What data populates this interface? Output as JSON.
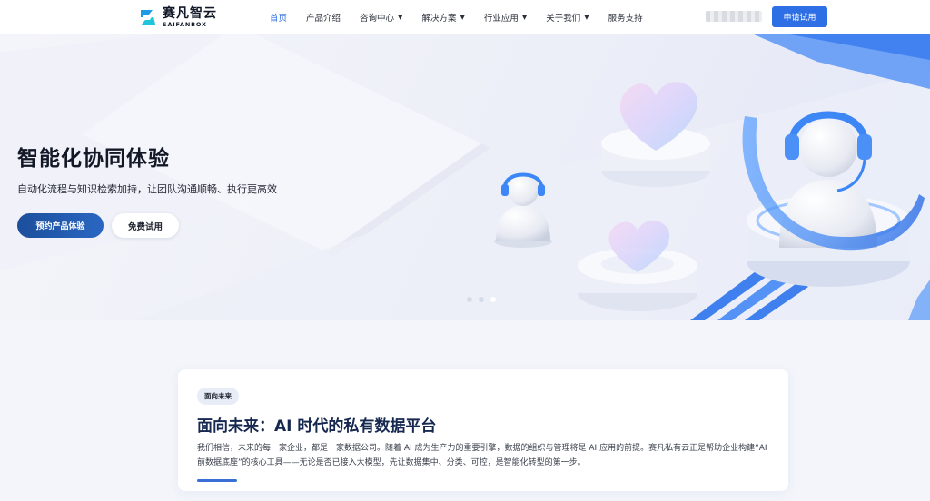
{
  "brand": {
    "name_cn": "赛凡智云",
    "name_en": "SAIFANBOX"
  },
  "nav": {
    "items": [
      {
        "label": "首页",
        "active": true,
        "dropdown": false
      },
      {
        "label": "产品介绍",
        "active": false,
        "dropdown": false
      },
      {
        "label": "咨询中心",
        "active": false,
        "dropdown": true
      },
      {
        "label": "解决方案",
        "active": false,
        "dropdown": true
      },
      {
        "label": "行业应用",
        "active": false,
        "dropdown": true
      },
      {
        "label": "关于我们",
        "active": false,
        "dropdown": true
      },
      {
        "label": "服务支持",
        "active": false,
        "dropdown": false
      }
    ],
    "apply_label": "申请试用"
  },
  "hero": {
    "title": "智能化协同体验",
    "subtitle": "自动化流程与知识检索加持，让团队沟通顺畅、执行更高效",
    "primary_button": "预约产品体验",
    "secondary_button": "免费试用",
    "slides": {
      "count": 3,
      "active": 3
    }
  },
  "section": {
    "badge": "面向未来",
    "title": "面向未来：AI 时代的私有数据平台",
    "body": "我们相信，未来的每一家企业，都是一家数据公司。随着 AI 成为生产力的重要引擎，数据的组织与管理将是 AI 应用的前提。赛凡私有云正是帮助企业构建“AI 前数据底座”的核心工具——无论是否已接入大模型，先让数据集中、分类、可控，是智能化转型的第一步。"
  },
  "colors": {
    "accent": "#2f6fe6",
    "primary_dark": "#1c4f9c",
    "title": "#16284f"
  }
}
